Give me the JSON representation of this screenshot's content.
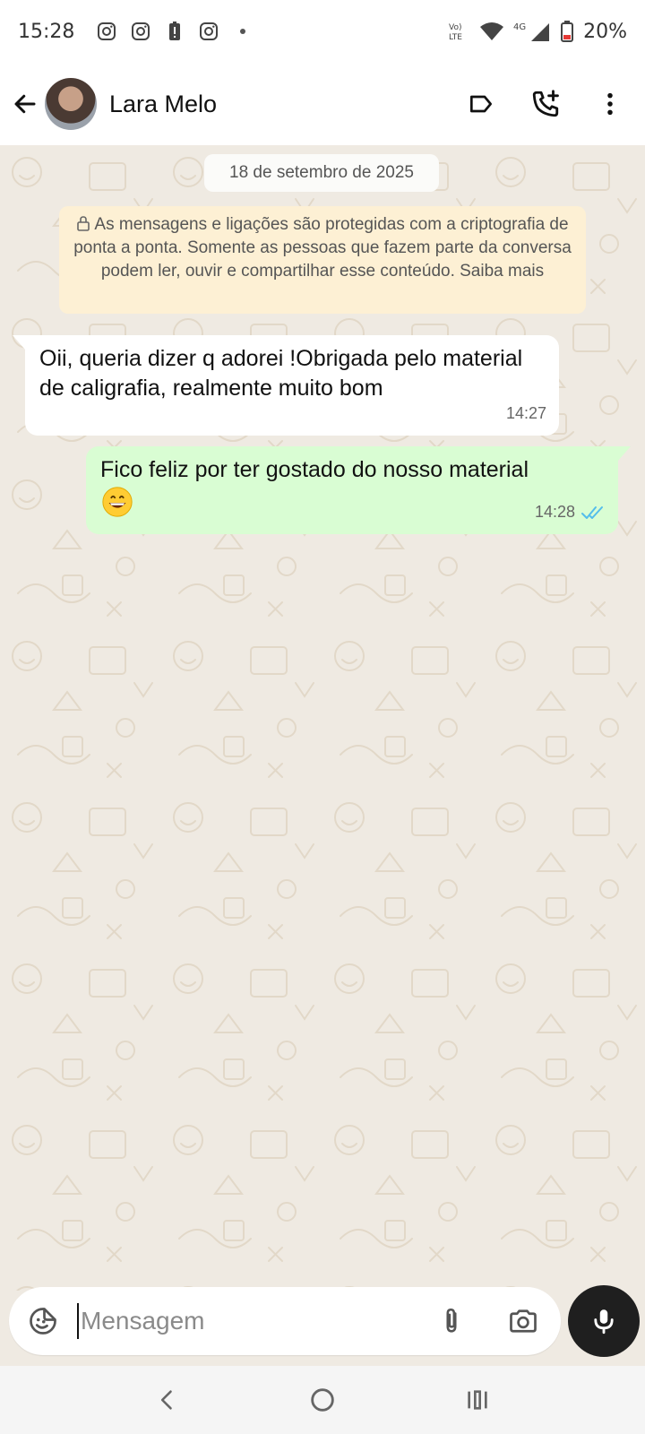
{
  "status_bar": {
    "time": "15:28",
    "battery": "20%",
    "network": "4G",
    "volte": "Vo) LTE"
  },
  "header": {
    "contact_name": "Lara Melo",
    "icons": [
      "back-arrow-icon",
      "label-icon",
      "add-call-icon",
      "more-vert-icon"
    ]
  },
  "chat": {
    "date_chip": "18 de setembro de 2025",
    "e2e_notice": "As mensagens e ligações são protegidas com a criptografia de ponta a ponta. Somente as pessoas que fazem parte da conversa podem ler, ouvir e compartilhar esse conteúdo. Saiba mais",
    "messages": [
      {
        "direction": "incoming",
        "text": "Oii, queria dizer q adorei !Obrigada pelo material de caligrafia, realmente muito bom",
        "time": "14:27"
      },
      {
        "direction": "outgoing",
        "text": "Fico feliz por ter gostado do nosso material",
        "emoji": "grinning-face-emoji",
        "time": "14:28",
        "status": "read"
      }
    ]
  },
  "composer": {
    "placeholder": "Mensagem",
    "value": ""
  },
  "colors": {
    "chat_background": "#efeae2",
    "outgoing_bubble": "#d9fdd3",
    "incoming_bubble": "#ffffff",
    "notice_background": "#fdf0d4",
    "read_ticks": "#53bdeb",
    "mic_button": "#1f1f1f"
  }
}
